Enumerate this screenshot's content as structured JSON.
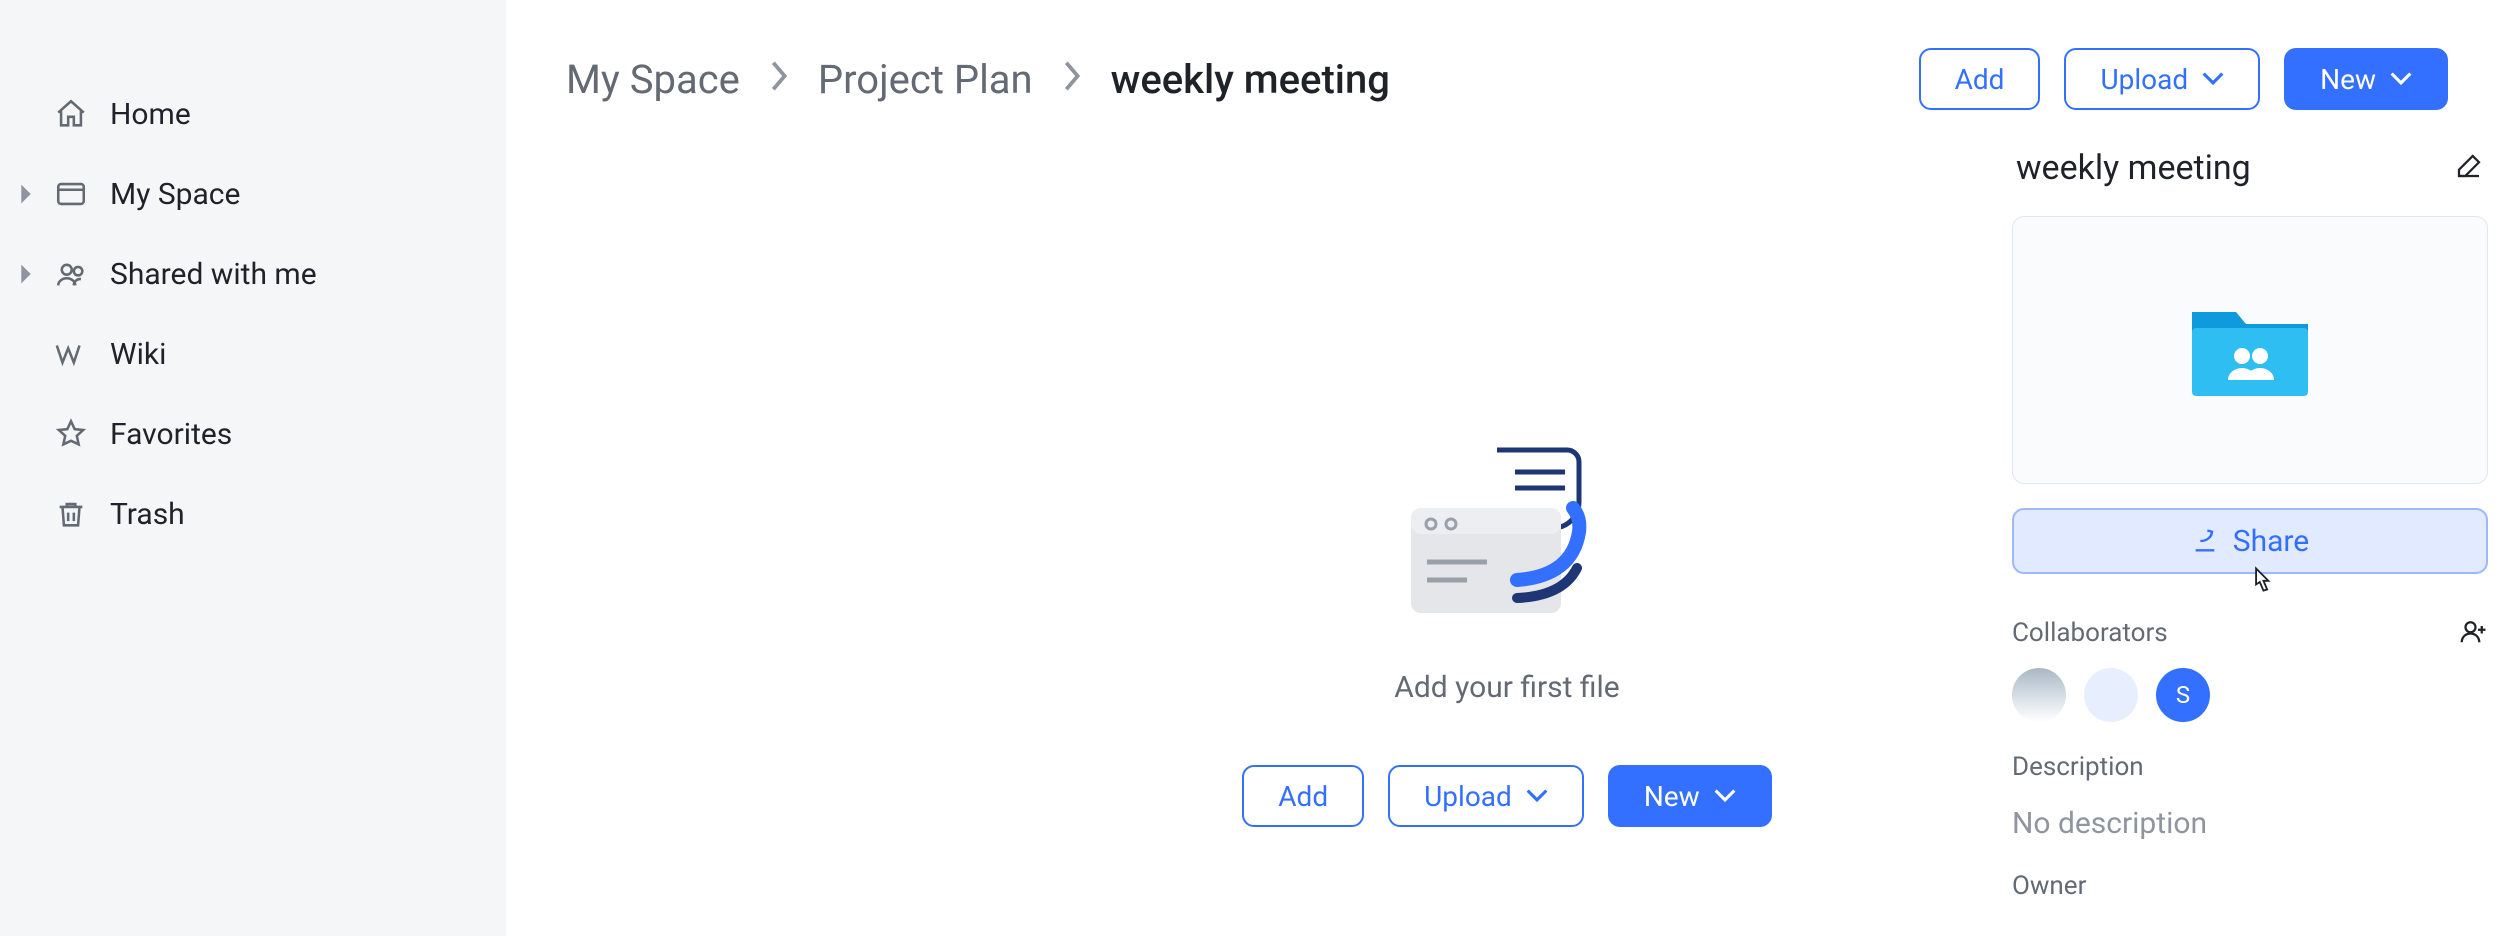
{
  "sidebar": {
    "items": [
      {
        "label": "Home",
        "icon": "home-icon",
        "expandable": false
      },
      {
        "label": "My Space",
        "icon": "space-icon",
        "expandable": true
      },
      {
        "label": "Shared with me",
        "icon": "people-icon",
        "expandable": true
      },
      {
        "label": "Wiki",
        "icon": "wiki-icon",
        "expandable": false
      },
      {
        "label": "Favorites",
        "icon": "star-icon",
        "expandable": false
      },
      {
        "label": "Trash",
        "icon": "trash-icon",
        "expandable": false
      }
    ]
  },
  "breadcrumb": {
    "items": [
      {
        "label": "My Space",
        "current": false
      },
      {
        "label": "Project Plan",
        "current": false
      },
      {
        "label": "weekly meeting",
        "current": true
      }
    ]
  },
  "topActions": {
    "add": "Add",
    "upload": "Upload",
    "new": "New"
  },
  "empty": {
    "caption": "Add your first file",
    "add": "Add",
    "upload": "Upload",
    "new": "New"
  },
  "details": {
    "title": "weekly meeting",
    "shareLabel": "Share",
    "collaboratorsLabel": "Collaborators",
    "collaborators": [
      {
        "type": "photo",
        "initial": ""
      },
      {
        "type": "light",
        "initial": ""
      },
      {
        "type": "blue",
        "initial": "S"
      }
    ],
    "descriptionLabel": "Description",
    "descriptionValue": "No description",
    "ownerLabel": "Owner"
  }
}
